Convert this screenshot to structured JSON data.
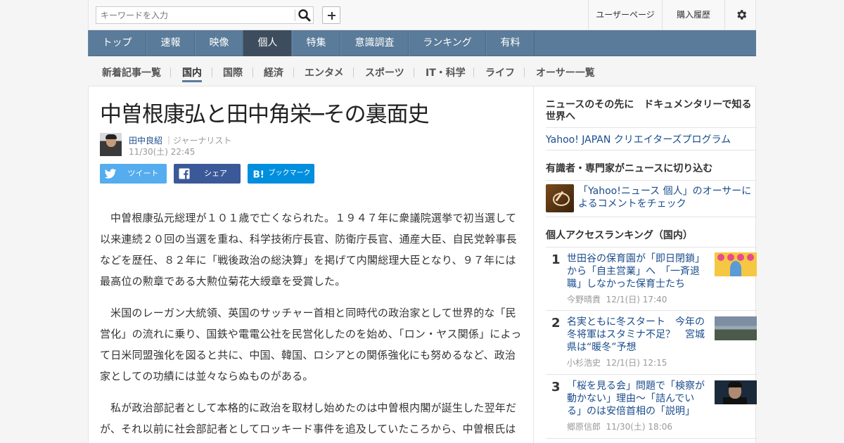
{
  "header": {
    "search_placeholder": "キーワードを入力",
    "user_page": "ユーザーページ",
    "purchase_history": "購入履歴"
  },
  "main_nav": [
    {
      "label": "トップ",
      "active": false
    },
    {
      "label": "速報",
      "active": false
    },
    {
      "label": "映像",
      "active": false
    },
    {
      "label": "個人",
      "active": true
    },
    {
      "label": "特集",
      "active": false
    },
    {
      "label": "意識調査",
      "active": false
    },
    {
      "label": "ランキング",
      "active": false
    },
    {
      "label": "有料",
      "active": false
    }
  ],
  "sub_nav": [
    {
      "label": "新着記事一覧",
      "active": false
    },
    {
      "label": "国内",
      "active": true
    },
    {
      "label": "国際",
      "active": false
    },
    {
      "label": "経済",
      "active": false
    },
    {
      "label": "エンタメ",
      "active": false
    },
    {
      "label": "スポーツ",
      "active": false
    },
    {
      "label": "IT・科学",
      "active": false
    },
    {
      "label": "ライフ",
      "active": false
    },
    {
      "label": "オーサー一覧",
      "active": false
    }
  ],
  "article": {
    "title": "中曽根康弘と田中角栄─その裏面史",
    "author_name": "田中良紹",
    "author_role": "｜ジャーナリスト",
    "date": "11/30(土) 22:45",
    "share": {
      "tweet": "ツイート",
      "share": "シェア",
      "bookmark": "ブックマーク"
    },
    "paragraphs": [
      "中曽根康弘元総理が１０１歳で亡くなられた。１９４７年に衆議院選挙で初当選して以来連続２０回の当選を重ね、科学技術庁長官、防衛庁長官、通産大臣、自民党幹事長などを歴任、８２年に「戦後政治の総決算」を掲げて内閣総理大臣となり、９７年には最高位の勲章である大勲位菊花大綬章を受賞した。",
      "米国のレーガン大統領、英国のサッチャー首相と同時代の政治家として世界的な「民営化」の流れに乗り、国鉄や電電公社を民営化したのを始め、「ロン・ヤス関係」によって日米同盟強化を図ると共に、中国、韓国、ロシアとの関係強化にも努めるなど、政治家としての功績には並々ならぬものがある。",
      "私が政治部記者として本格的に政治を取材し始めたのは中曽根内閣が誕生した翌年だが、それ以前に社会部記者としてロッキード事件を追及していたころから、中曽根氏は私"
    ]
  },
  "sidebar": {
    "documentary_heading": "ニュースのその先に　ドキュメンタリーで知る世界へ",
    "creators_link": "Yahoo! JAPAN クリエイターズプログラム",
    "experts_heading": "有識者・専門家がニュースに切り込む",
    "experts_link": "「Yahoo!ニュース 個人」のオーサーによるコメントをチェック",
    "ranking_heading": "個人アクセスランキング（国内）",
    "ranking": [
      {
        "rank": "1",
        "title": "世田谷の保育園が「即日閉鎖」から「自主営業」へ　「一斉退職」しなかった保育士たち",
        "author": "今野晴貴",
        "date": "12/1(日) 17:40"
      },
      {
        "rank": "2",
        "title": "名実ともに冬スタート　今年の冬将軍はスタミナ不足？　宮城県は“暖冬”予想",
        "author": "小杉浩史",
        "date": "12/1(日) 12:15"
      },
      {
        "rank": "3",
        "title": "「桜を見る会」問題で「検察が動かない」理由～「詰んでいる」のは安倍首相の「説明」",
        "author": "郷原信郎",
        "date": "11/30(土) 18:06"
      }
    ]
  }
}
